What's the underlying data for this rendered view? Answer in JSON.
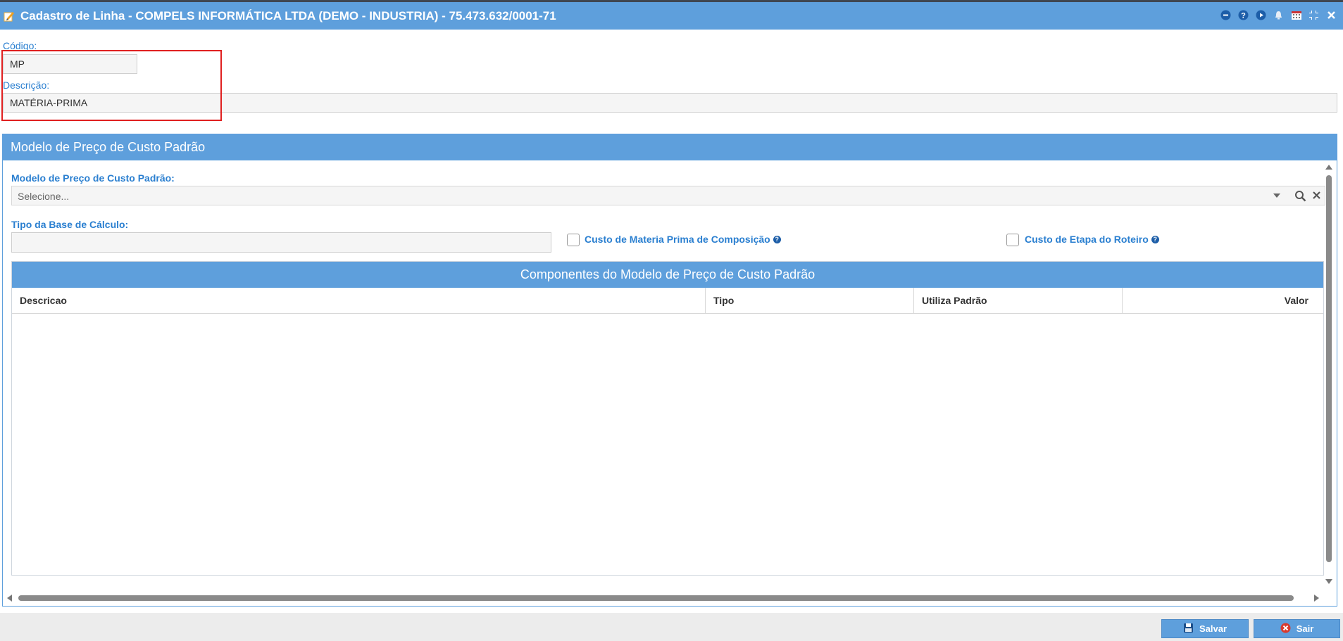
{
  "window": {
    "title": "Cadastro de Linha - COMPELS INFORMÁTICA LTDA (DEMO - INDUSTRIA) - 75.473.632/0001-71",
    "icons": [
      "minimize-icon",
      "help-icon",
      "play-icon",
      "bell-icon",
      "calendar-icon",
      "shrink-icon",
      "close-icon"
    ]
  },
  "form": {
    "codigo_label": "Código:",
    "codigo_value": "MP",
    "descricao_label": "Descrição:",
    "descricao_value": "MATÉRIA-PRIMA"
  },
  "panel": {
    "title": "Modelo de Preço de Custo Padrão",
    "modelo_label": "Modelo de Preço de Custo Padrão:",
    "modelo_placeholder": "Selecione...",
    "tipo_base_label": "Tipo da Base de Cálculo:",
    "tipo_base_value": "",
    "check_materia_prima": {
      "label": "Custo de Materia Prima de Composição",
      "checked": false
    },
    "check_etapa_roteiro": {
      "label": "Custo de Etapa do Roteiro",
      "checked": false
    }
  },
  "grid": {
    "title": "Componentes do Modelo de Preço de Custo Padrão",
    "columns": [
      "Descricao",
      "Tipo",
      "Utiliza Padrão",
      "Valor"
    ],
    "rows": []
  },
  "footer": {
    "save_label": "Salvar",
    "exit_label": "Sair"
  },
  "colors": {
    "header_blue": "#5e9fdc",
    "label_blue": "#2a7fd0",
    "highlight_red": "#e02020"
  }
}
